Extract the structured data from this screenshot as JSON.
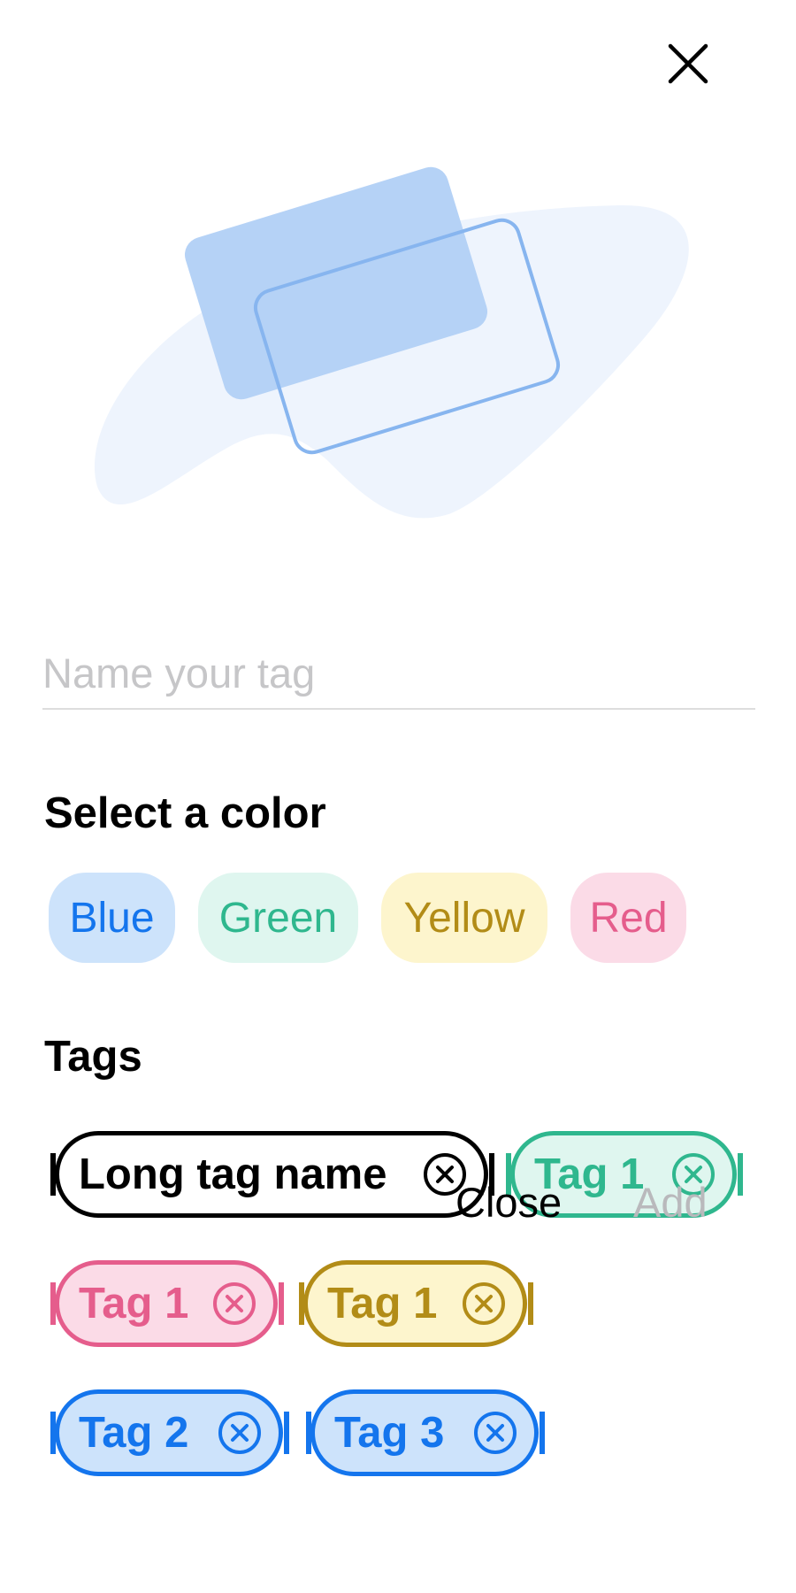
{
  "header": {
    "close_icon": "close-icon"
  },
  "illustration": {
    "icon": "tag-cards-illustration",
    "colors": {
      "blob": "#eef4fd",
      "card_fill": "#b1d0f6",
      "card_outline": "#87b5ef"
    }
  },
  "name_input": {
    "placeholder": "Name your tag",
    "value": ""
  },
  "color_section": {
    "heading": "Select a color",
    "options": [
      {
        "label": "Blue",
        "bg": "#cde3fb",
        "fg": "#1475ed"
      },
      {
        "label": "Green",
        "bg": "#dff6ef",
        "fg": "#2fb78e"
      },
      {
        "label": "Yellow",
        "bg": "#fdf5cd",
        "fg": "#b28c17"
      },
      {
        "label": "Red",
        "bg": "#fbdbe7",
        "fg": "#e55d8c"
      }
    ]
  },
  "tags_section": {
    "heading": "Tags",
    "tags": [
      {
        "label": "Long tag name",
        "color": "black",
        "remove_icon": "remove-circle-icon"
      },
      {
        "label": "Tag 1",
        "color": "green",
        "remove_icon": "remove-circle-icon"
      },
      {
        "label": "Tag 1",
        "color": "red",
        "remove_icon": "remove-circle-icon"
      },
      {
        "label": "Tag 1",
        "color": "yellow",
        "remove_icon": "remove-circle-icon"
      },
      {
        "label": "Tag 2",
        "color": "blue",
        "remove_icon": "remove-circle-icon"
      },
      {
        "label": "Tag 3",
        "color": "blue",
        "remove_icon": "remove-circle-icon"
      }
    ]
  },
  "actions": {
    "close_label": "Close",
    "add_label": "Add"
  }
}
